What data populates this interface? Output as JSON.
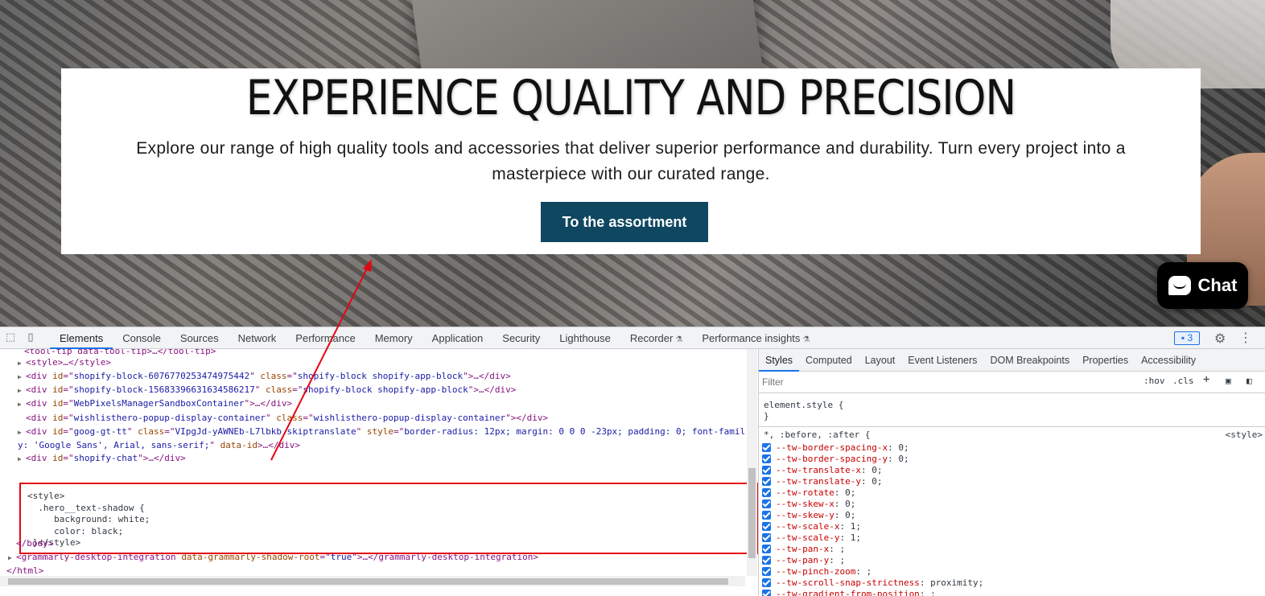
{
  "hero": {
    "title": "EXPERIENCE QUALITY AND PRECISION",
    "text": "Explore our range of high quality tools and accessories that deliver superior performance and durability. Turn every project into a masterpiece with our curated range.",
    "button_label": "To the assortment",
    "button_color": "#0f4761"
  },
  "chat": {
    "label": "Chat"
  },
  "devtools": {
    "tabs": [
      "Elements",
      "Console",
      "Sources",
      "Network",
      "Performance",
      "Memory",
      "Application",
      "Security",
      "Lighthouse",
      "Recorder",
      "Performance insights"
    ],
    "active_tab": "Elements",
    "issues_count": "3",
    "elements_lines": {
      "l0": "<tool-tip data-tool-tip>…</tool-tip>",
      "l1_tag": "<style>…</style>",
      "l2_id": "shopify-block-6076770253474975442",
      "l2_class": "shopify-block shopify-app-block",
      "l3_id": "shopify-block-15683396631634586217",
      "l3_class": "shopify-block shopify-app-block",
      "l4_id": "WebPixelsManagerSandboxContainer",
      "l5_id": "wishlisthero-popup-display-container",
      "l5_class": "wishlisthero-popup-display-container",
      "l6_id": "goog-gt-tt",
      "l6_class": "VIpgJd-yAWNEb-L7lbkb skiptranslate",
      "l6_style_a": "border-radius: 12px; margin: 0 0 0 -23px; padding: 0; font-famil",
      "l6_style_b": "y: 'Google Sans', Arial, sans-serif;",
      "l6_dataid": "data-id",
      "l7_id": "shopify-chat",
      "body_close": "</body>",
      "grammarly": "grammarly-desktop-integration",
      "grammarly_attr": "data-grammarly-shadow-root",
      "grammarly_val": "true",
      "html_close": "</html>"
    },
    "edited_code": "<style>\n  .hero__text-shadow {\n     background: white;\n     color: black;\n }</style>"
  },
  "styles_pane": {
    "tabs": [
      "Styles",
      "Computed",
      "Layout",
      "Event Listeners",
      "DOM Breakpoints",
      "Properties",
      "Accessibility"
    ],
    "active_tab": "Styles",
    "filter_placeholder": "Filter",
    "hov": ":hov",
    "cls": ".cls",
    "element_style": "element.style {",
    "close_brace": "}",
    "universal_selector": "*, :before, :after {",
    "universal_source": "<style>",
    "properties": [
      {
        "name": "--tw-border-spacing-x",
        "value": "0"
      },
      {
        "name": "--tw-border-spacing-y",
        "value": "0"
      },
      {
        "name": "--tw-translate-x",
        "value": "0"
      },
      {
        "name": "--tw-translate-y",
        "value": "0"
      },
      {
        "name": "--tw-rotate",
        "value": "0"
      },
      {
        "name": "--tw-skew-x",
        "value": "0"
      },
      {
        "name": "--tw-skew-y",
        "value": "0"
      },
      {
        "name": "--tw-scale-x",
        "value": "1"
      },
      {
        "name": "--tw-scale-y",
        "value": "1"
      },
      {
        "name": "--tw-pan-x",
        "value": " "
      },
      {
        "name": "--tw-pan-y",
        "value": " "
      },
      {
        "name": "--tw-pinch-zoom",
        "value": " "
      },
      {
        "name": "--tw-scroll-snap-strictness",
        "value": "proximity"
      },
      {
        "name": "--tw-gradient-from-position",
        "value": " "
      }
    ]
  },
  "annotation_color": "#e30613"
}
